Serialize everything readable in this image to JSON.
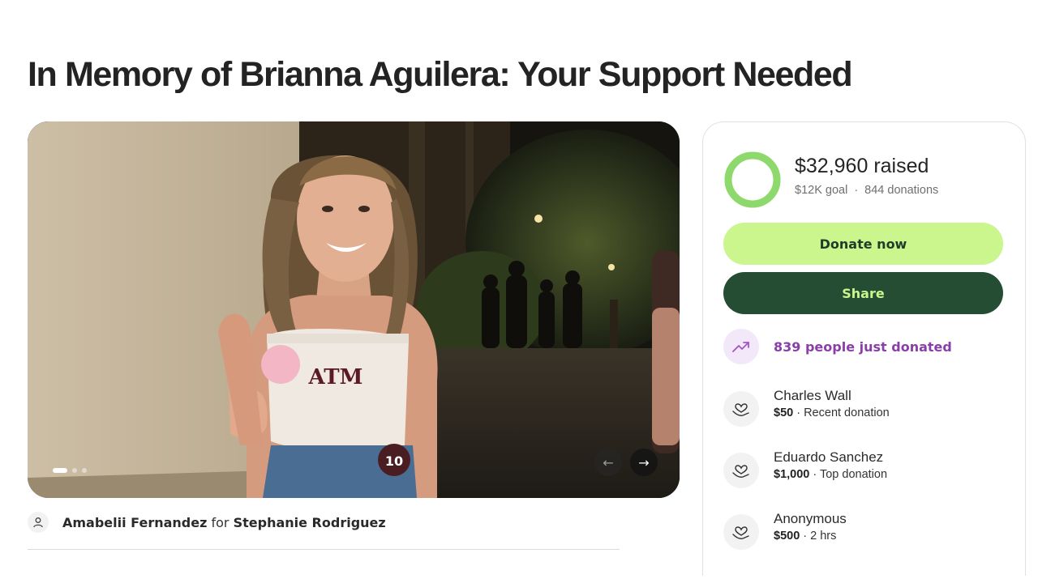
{
  "title": "In Memory of Brianna Aguilera: Your Support Needed",
  "hero": {
    "image_alt": "Photo of Brianna Aguilera",
    "slide_count": 3,
    "active_slide": 1,
    "prev_icon": "arrow-left-icon",
    "next_icon": "arrow-right-icon"
  },
  "organizer": {
    "avatar_icon": "person-icon",
    "name": "Amabelii Fernandez",
    "connector": "for",
    "beneficiary": "Stephanie Rodriguez"
  },
  "donation_card": {
    "raised": "$32,960 raised",
    "goal": "$12K goal",
    "separator": "·",
    "donations": "844 donations",
    "progress_fraction": 1.0,
    "donate_label": "Donate now",
    "share_label": "Share",
    "trend_icon": "trending-up-icon",
    "trend_text": "839 people just donated",
    "donors": [
      {
        "name": "Charles Wall",
        "amount": "$50",
        "note": " · Recent donation",
        "icon": "heart-hand-icon"
      },
      {
        "name": "Eduardo Sanchez",
        "amount": "$1,000",
        "note": " · Top donation",
        "icon": "heart-hand-icon"
      },
      {
        "name": "Anonymous",
        "amount": "$500",
        "note": " · 2 hrs",
        "icon": "heart-hand-icon"
      }
    ]
  },
  "colors": {
    "accent_green": "#cbf68e",
    "dark_green": "#254d34",
    "ring_green": "#8ed96c",
    "trend_purple": "#8a3ea8"
  }
}
